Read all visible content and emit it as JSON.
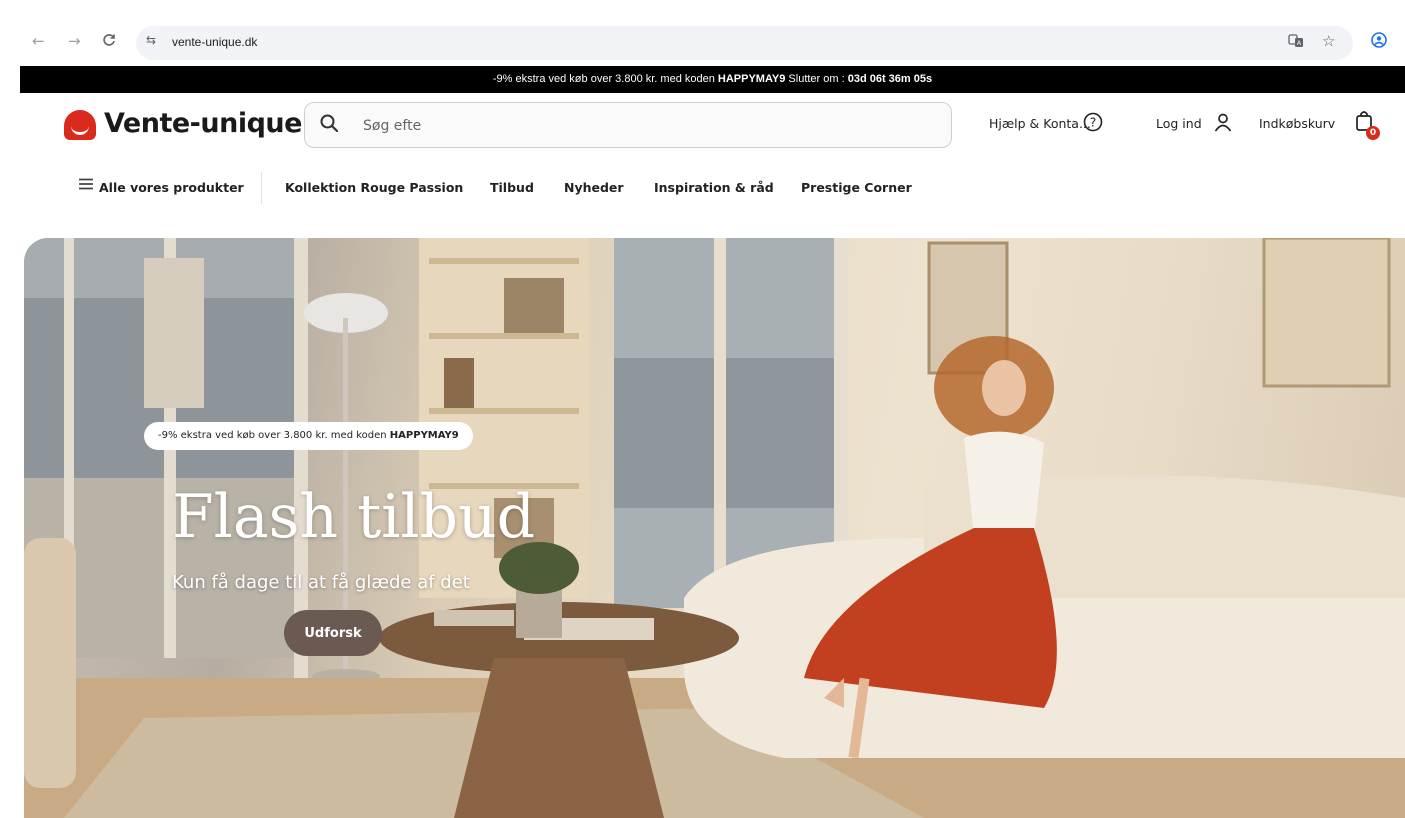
{
  "browser": {
    "url": "vente-unique.dk",
    "back_icon": "←",
    "forward_icon": "→",
    "reload_icon": "C",
    "site_info_icon": "⇆",
    "translate_icon": "A",
    "star_icon": "☆",
    "profile_icon": "◉"
  },
  "promo_bar": {
    "text_before": "-9% ekstra ved køb over 3.800 kr. med koden ",
    "code": "HAPPYMAY9",
    "text_after": " Slutter om : ",
    "countdown": "03d 06t 36m 05s"
  },
  "header": {
    "logo_text": "Vente-unique",
    "search_placeholder": "Søg efte",
    "search_icon": "⚲",
    "help_label": "Hjælp & Konta...",
    "help_icon": "?",
    "login_label": "Log ind",
    "user_icon": "⌂",
    "cart_label": "Indkøbskurv",
    "cart_icon": "▢",
    "cart_count": "0"
  },
  "nav": {
    "menu_icon": "☰",
    "all_products": "Alle vores produkter",
    "items": [
      "Kollektion Rouge Passion",
      "Tilbud",
      "Nyheder",
      "Inspiration & råd",
      "Prestige Corner"
    ]
  },
  "hero": {
    "promo_text_before": "-9% ekstra ved køb over 3.800 kr. med koden ",
    "promo_code": "HAPPYMAY9",
    "title": "Flash tilbud",
    "subtitle": "Kun få dage til at få glæde af det",
    "cta_label": "Udforsk"
  },
  "colors": {
    "brand_red": "#d92a1c",
    "promo_bar_bg": "#000000",
    "cta_bg": "#6b5a52"
  }
}
